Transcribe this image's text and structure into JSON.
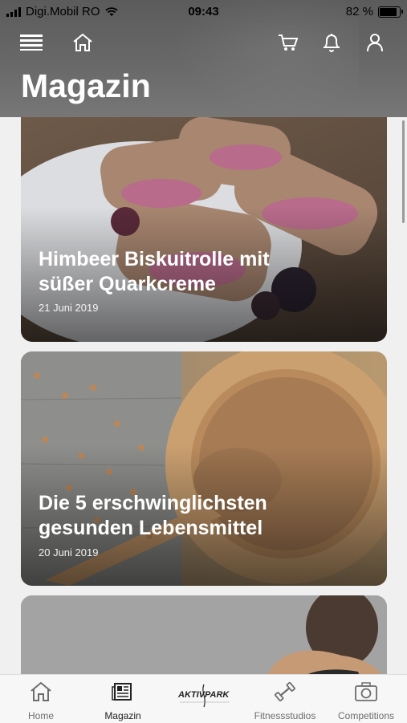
{
  "status_bar": {
    "carrier": "Digi.Mobil RO",
    "time": "09:43",
    "battery": "82 %",
    "battery_level": 0.82
  },
  "header": {
    "title": "Magazin",
    "icons": [
      "menu-icon",
      "home-icon",
      "cart-icon",
      "bell-icon",
      "user-icon"
    ]
  },
  "articles": [
    {
      "title_line1": "Himbeer Biskuitrolle mit",
      "title_line2": "süßer Quarkcreme",
      "date": "21 Juni 2019"
    },
    {
      "title_line1": "Die 5 erschwinglichsten",
      "title_line2": "gesunden Lebensmittel",
      "date": "20 Juni 2019"
    },
    {
      "title_line1": "",
      "title_line2": "",
      "date": ""
    }
  ],
  "tabbar": {
    "tabs": [
      {
        "label": "Home",
        "icon": "house-icon"
      },
      {
        "label": "Magazin",
        "icon": "newspaper-icon",
        "active": true
      },
      {
        "label": "",
        "icon": "aktivpark-logo",
        "logo_text": "AKTIVPARK"
      },
      {
        "label": "Fitnessstudios",
        "icon": "dumbbell-icon"
      },
      {
        "label": "Competitions",
        "icon": "camera-icon"
      }
    ]
  },
  "colors": {
    "header_bg": "#666666",
    "text_light": "#ffffff",
    "tab_inactive": "#6d6d6d"
  }
}
